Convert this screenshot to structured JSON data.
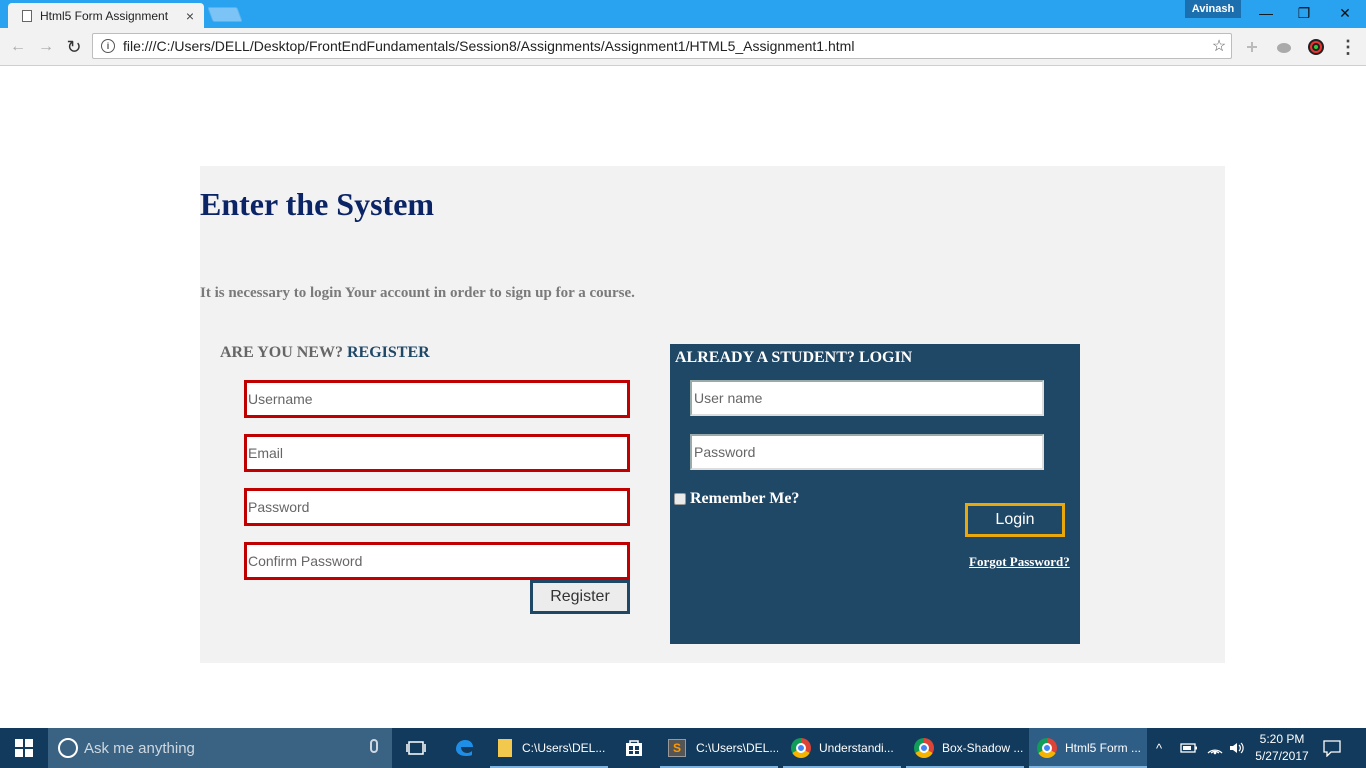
{
  "browser": {
    "tab_title": "Html5 Form Assignment",
    "tab_close": "×",
    "profile_name": "Avinash",
    "url": "file:///C:/Users/DELL/Desktop/FrontEndFundamentals/Session8/Assignments/Assignment1/HTML5_Assignment1.html",
    "info_glyph": "i",
    "back_glyph": "←",
    "forward_glyph": "→",
    "reload_glyph": "↻",
    "star_glyph": "☆",
    "menu_glyph": "⋮",
    "minimize_glyph": "—",
    "restore_glyph": "❐",
    "close_glyph": "✕"
  },
  "page": {
    "heading": "Enter the System",
    "intro": "It is necessary to login Your account in order to sign up for a course.",
    "register": {
      "heading_prefix": "ARE YOU NEW? ",
      "heading_highlight": "REGISTER",
      "username_placeholder": "Username",
      "email_placeholder": "Email",
      "password_placeholder": "Password",
      "confirm_placeholder": "Confirm Password",
      "button_label": "Register",
      "input_border_color": "#c00000",
      "button_border_color": "#1f4766"
    },
    "login": {
      "heading": "ALREADY A STUDENT? LOGIN",
      "username_placeholder": "User name",
      "password_placeholder": "Password",
      "remember_label": "Remember Me?",
      "remember_checked": false,
      "button_label": "Login",
      "forgot_label": "Forgot Password?",
      "background_color": "#1f4766",
      "button_border_color": "#e9a80c"
    }
  },
  "taskbar": {
    "search_placeholder": "Ask me anything",
    "apps": [
      {
        "label": "C:\\Users\\DEL...",
        "icon": "folder-icon"
      },
      {
        "label": "C:\\Users\\DEL...",
        "icon": "sublime-icon"
      },
      {
        "label": "Understandi...",
        "icon": "chrome-icon"
      },
      {
        "label": "Box-Shadow ...",
        "icon": "chrome-icon"
      },
      {
        "label": "Html5 Form ...",
        "icon": "chrome-icon",
        "active": true
      }
    ],
    "time": "5:20 PM",
    "date": "5/27/2017"
  }
}
